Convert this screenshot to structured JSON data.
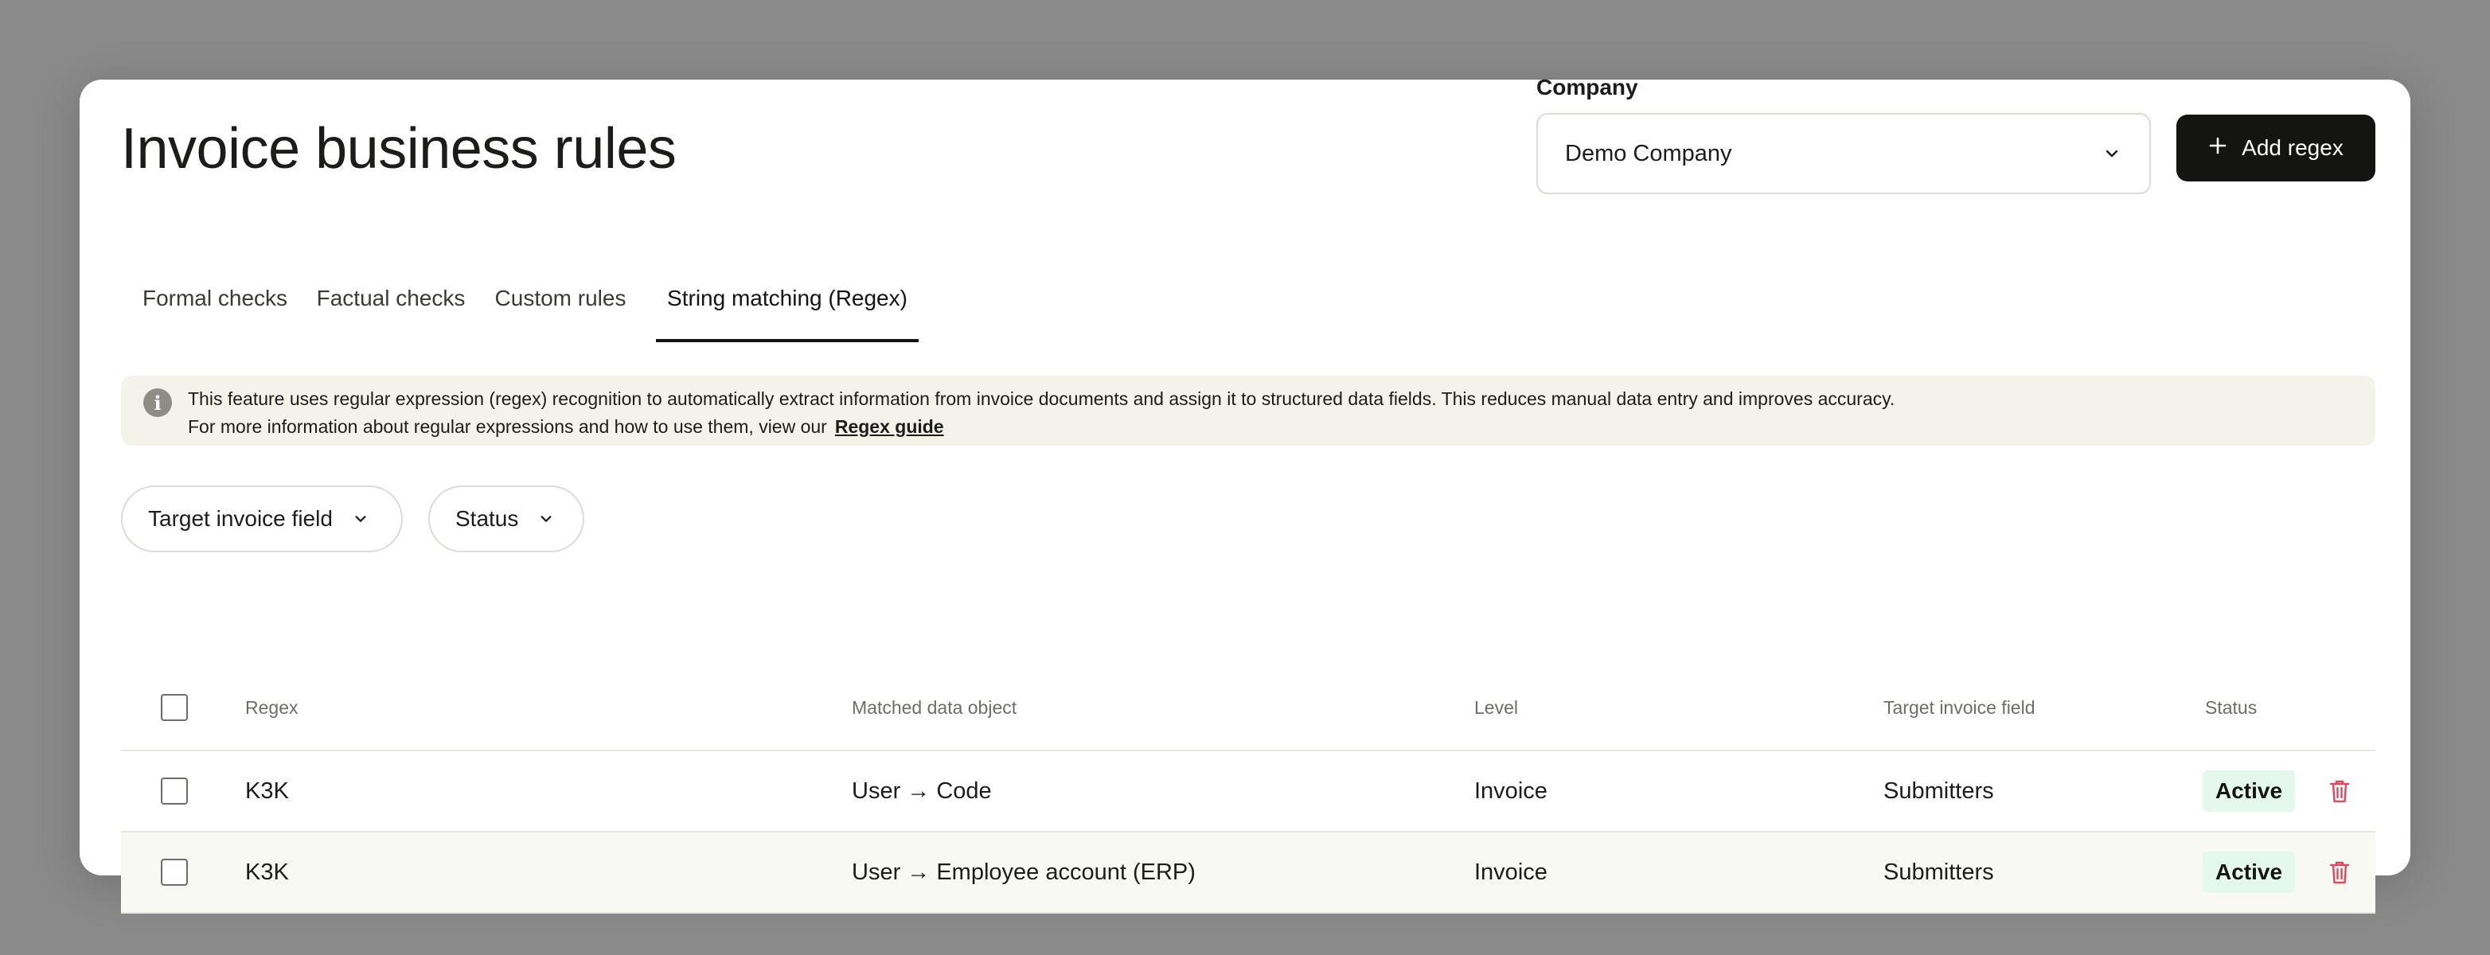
{
  "header": {
    "title": "Invoice business rules",
    "company_label": "Company",
    "company_value": "Demo Company",
    "add_button_label": "Add regex"
  },
  "tabs": [
    {
      "label": "Formal checks"
    },
    {
      "label": "Factual checks"
    },
    {
      "label": "Custom rules"
    },
    {
      "label": "String matching (Regex)",
      "active": true
    }
  ],
  "info": {
    "line1": "This feature uses regular expression (regex) recognition to automatically extract information from invoice documents and assign it to structured data fields. This reduces manual data entry and improves accuracy.",
    "line2": "For more information about regular expressions and how to use them, view our",
    "link_label": "Regex guide"
  },
  "filters": [
    {
      "label": "Target invoice field"
    },
    {
      "label": "Status"
    }
  ],
  "table": {
    "columns": [
      "Regex",
      "Matched data object",
      "Level",
      "Target invoice field",
      "Status"
    ],
    "rows": [
      {
        "regex": "K3K",
        "matched": "User → Code",
        "level": "Invoice",
        "target": "Submitters",
        "status": "Active"
      },
      {
        "regex": "K3K",
        "matched": "User → Employee account (ERP)",
        "level": "Invoice",
        "target": "Submitters",
        "status": "Active"
      }
    ]
  },
  "colors": {
    "primary": "#141412",
    "info_bg": "#f3f3ea",
    "status_active_bg": "#e4f8ee",
    "danger": "#e0485f"
  },
  "icons": {
    "info": "info-icon",
    "chevron": "chevron-down-icon",
    "add": "plus-icon",
    "delete": "trash-icon"
  }
}
